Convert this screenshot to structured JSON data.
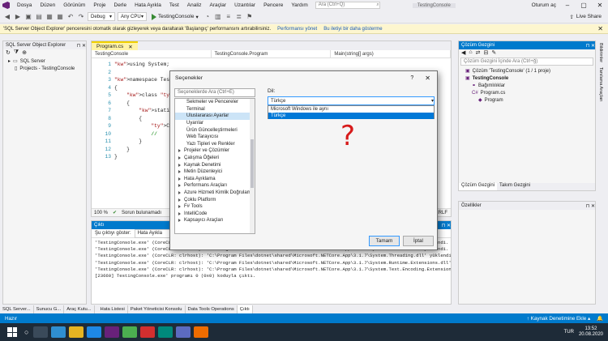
{
  "menubar": {
    "items": [
      "Dosya",
      "Düzen",
      "Görünüm",
      "Proje",
      "Derle",
      "Hata Ayıkla",
      "Test",
      "Analiz",
      "Araçlar",
      "Uzantılar",
      "Pencere",
      "Yardım"
    ],
    "search_placeholder": "Ara (Ctrl+Q)",
    "project_name": "TestingConsole",
    "signin": "Oturum aç"
  },
  "toolbar": {
    "config": "Debug",
    "platform": "Any CPU",
    "run_label": "TestingConsole",
    "live_share": "Live Share"
  },
  "infobar": {
    "message": "'SQL Server Object Explorer' penceresini otomatik olarak gizleyerek veya daraltarak 'Başlangıç' performansını artırabilirsiniz.",
    "link1": "Performansı yönet",
    "link2": "Bu iletiyi bir daha gösterme"
  },
  "left_panel": {
    "title": "SQL Server Object Explorer",
    "items": [
      "SQL Server",
      "Projects - TestingConsole"
    ]
  },
  "editor": {
    "tab": "Program.cs",
    "nav": [
      "TestingConsole",
      "TestingConsole.Program",
      "Main(string[] args)"
    ],
    "lines": [
      {
        "n": "1",
        "code": "using System;"
      },
      {
        "n": "2",
        "code": ""
      },
      {
        "n": "3",
        "code": "namespace TestingConsole"
      },
      {
        "n": "4",
        "code": "{"
      },
      {
        "n": "5",
        "code": "    class Program"
      },
      {
        "n": "6",
        "code": "    {"
      },
      {
        "n": "7",
        "code": "        static void Main(string[] args)"
      },
      {
        "n": "8",
        "code": "        {"
      },
      {
        "n": "9",
        "code": "            Console.WriteLine(\"Hello World!\");"
      },
      {
        "n": "10",
        "code": "            //"
      },
      {
        "n": "11",
        "code": "        }"
      },
      {
        "n": "12",
        "code": "    }"
      },
      {
        "n": "13",
        "code": "}"
      }
    ],
    "zoom": "100 %",
    "issues": "Sorun bulunamadı",
    "crlf": "CRLF"
  },
  "output": {
    "title": "Çıktı",
    "show_from_label": "Şu çıktıyı göster:",
    "show_from_value": "Hata Ayıkla",
    "lines": [
      "'TestingConsole.exe' (CoreCLR: clrhost): 'C:\\Program Files\\dotnet\\shared\\Microsoft.NETCore.App\\3.1.7\\System.Runtime.dll' yüklendi.",
      "'TestingConsole.exe' (CoreCLR: clrhost): 'C:\\Program Files\\dotnet\\shared\\Microsoft.NETCore.App\\3.1.7\\System.Console.dll' yüklendi.",
      "'TestingConsole.exe' (CoreCLR: clrhost): 'C:\\Program Files\\dotnet\\shared\\Microsoft.NETCore.App\\3.1.7\\System.Threading.dll' yüklendi.",
      "'TestingConsole.exe' (CoreCLR: clrhost): 'C:\\Program Files\\dotnet\\shared\\Microsoft.NETCore.App\\3.1.7\\System.Runtime.Extensions.dll' yüklendi.",
      "'TestingConsole.exe' (CoreCLR: clrhost): 'C:\\Program Files\\dotnet\\shared\\Microsoft.NETCore.App\\3.1.7\\System.Text.Encoding.Extensions.dll' yüklendi.",
      "[23660] TestingConsole.exe' programı 0 (0x0) koduyla çıktı."
    ]
  },
  "solution_explorer": {
    "title": "Çözüm Gezgini",
    "search_placeholder": "Çözüm Gezgini İçinde Ara (Ctrl+ğ)",
    "items": [
      {
        "label": "Çözüm 'TestingConsole' (1 / 1 proje)",
        "indent": 1
      },
      {
        "label": "TestingConsole",
        "indent": 1
      },
      {
        "label": "Bağımlılıklar",
        "indent": 2
      },
      {
        "label": "Program.cs",
        "indent": 2
      },
      {
        "label": "Program",
        "indent": 3
      }
    ],
    "tabs": [
      "Çözüm Gezgini",
      "Takım Gezgini"
    ]
  },
  "properties": {
    "title": "Özellikler"
  },
  "side_tabs": [
    "Bildirimler",
    "Tanılama Araçları"
  ],
  "bottom_tabs": [
    "SQL Server...",
    "Sunucu G...",
    "Araç Kutu...",
    "Hata Listesi",
    "Paket Yöneticisi Konsolu",
    "Data Tools Operations",
    "Çıktı"
  ],
  "statusbar": {
    "left": "Hazır",
    "right": "Kaynak Denetimine Ekle"
  },
  "taskbar": {
    "time": "13:52",
    "date": "20.08.2020",
    "lang": "TUR"
  },
  "dialog": {
    "title": "Seçenekler",
    "search_placeholder": "Seçeneklerde Ara (Ctrl+E)",
    "options": [
      {
        "label": "Sekmeler ve Pencereler",
        "cat": false,
        "sel": false
      },
      {
        "label": "Terminal",
        "cat": false,
        "sel": false
      },
      {
        "label": "Uluslararası Ayarlar",
        "cat": false,
        "sel": true
      },
      {
        "label": "Uyarılar",
        "cat": false,
        "sel": false
      },
      {
        "label": "Ürün Güncelleştirmeleri",
        "cat": false,
        "sel": false
      },
      {
        "label": "Web Tarayıcısı",
        "cat": false,
        "sel": false
      },
      {
        "label": "Yazı Tipleri ve Renkler",
        "cat": false,
        "sel": false
      },
      {
        "label": "Projeler ve Çözümler",
        "cat": true,
        "sel": false
      },
      {
        "label": "Çalışma Öğeleri",
        "cat": true,
        "sel": false
      },
      {
        "label": "Kaynak Denetimi",
        "cat": true,
        "sel": false
      },
      {
        "label": "Metin Düzenleyici",
        "cat": true,
        "sel": false
      },
      {
        "label": "Hata Ayıklama",
        "cat": true,
        "sel": false
      },
      {
        "label": "Performans Araçları",
        "cat": true,
        "sel": false
      },
      {
        "label": "Azure Hizmeti Kimlik Doğrulaması",
        "cat": true,
        "sel": false
      },
      {
        "label": "Çoklu Platform",
        "cat": true,
        "sel": false
      },
      {
        "label": "F# Tools",
        "cat": true,
        "sel": false
      },
      {
        "label": "IntelliCode",
        "cat": true,
        "sel": false
      },
      {
        "label": "Kapsayıcı Araçları",
        "cat": true,
        "sel": false
      }
    ],
    "language_label": "Dil:",
    "language_value": "Türkçe",
    "language_options": [
      "Microsoft Windows ile aynı",
      "Türkçe"
    ],
    "question_mark": "?",
    "ok": "Tamam",
    "cancel": "İptal"
  }
}
